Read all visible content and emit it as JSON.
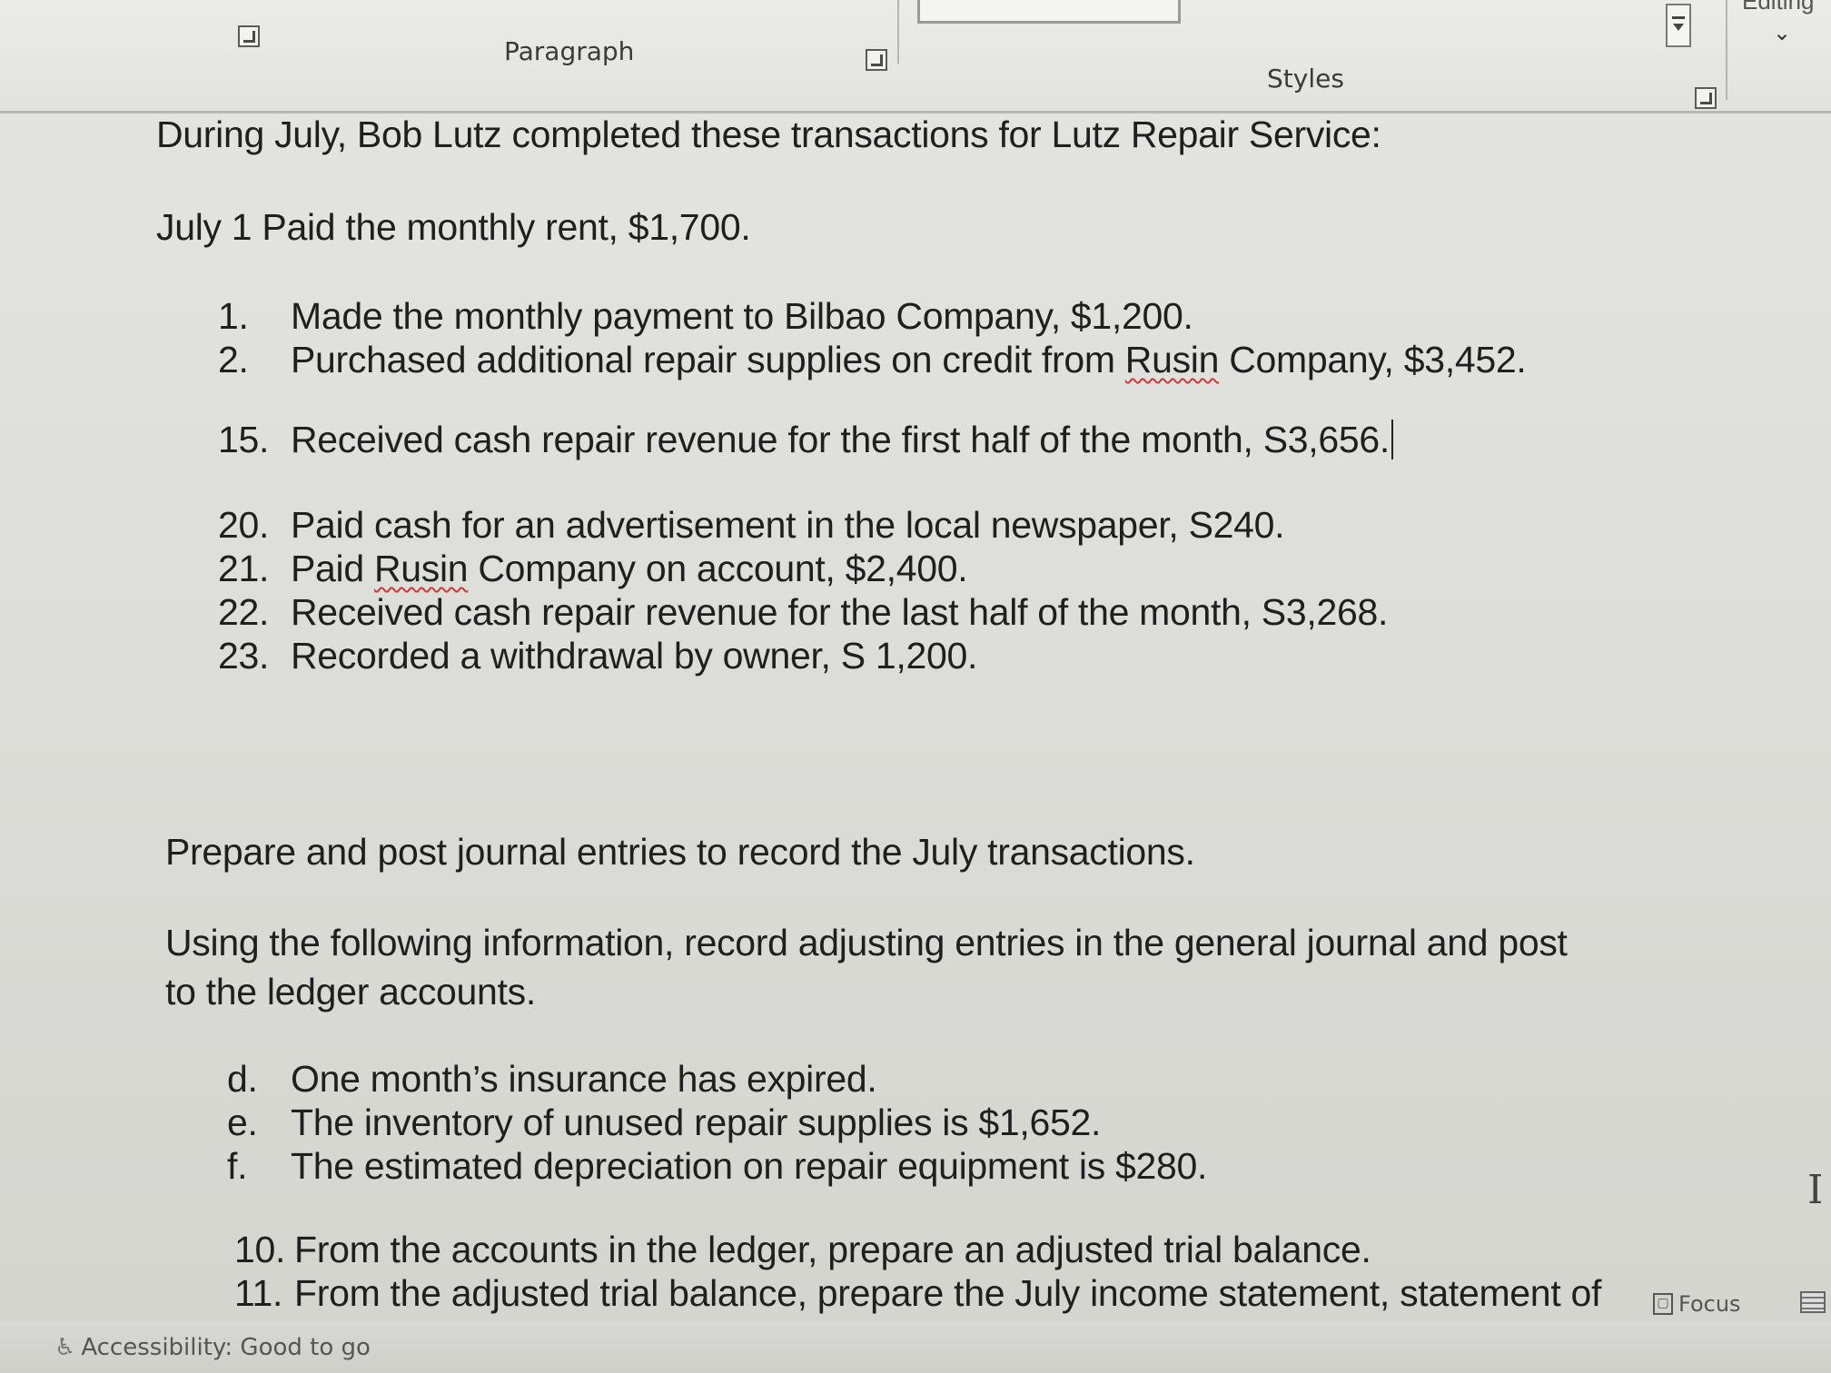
{
  "ribbon": {
    "paragraph_label": "Paragraph",
    "styles_label": "Styles",
    "editing_label": "Editing",
    "collapse_glyph": "⌄"
  },
  "document": {
    "heading": "During July, Bob Lutz completed these transactions for Lutz Repair Service:",
    "first_transaction": "July 1 Paid the monthly rent, $1,700.",
    "transactions": [
      {
        "num": "1.",
        "pre": "Made the monthly payment to Bilbao Company, $1,200.",
        "flagged": "",
        "post": ""
      },
      {
        "num": "2.",
        "pre": "Purchased additional repair supplies on credit from ",
        "flagged": "Rusin",
        "post": " Company, $3,452."
      },
      {
        "num": "15.",
        "pre": "Received cash repair revenue for the first half of the month, S3,656.",
        "flagged": "",
        "post": ""
      },
      {
        "num": "20.",
        "pre": "Paid cash for an advertisement in the local newspaper, S240.",
        "flagged": "",
        "post": ""
      },
      {
        "num": "21.",
        "pre": "Paid ",
        "flagged": "Rusin",
        "post": " Company on account, $2,400."
      },
      {
        "num": "22.",
        "pre": "Received cash repair revenue for the last half of the month, S3,268.",
        "flagged": "",
        "post": ""
      },
      {
        "num": "23.",
        "pre": "Recorded a withdrawal by owner, S 1,200.",
        "flagged": "",
        "post": ""
      }
    ],
    "instruction_1": "Prepare and post journal entries to record the July transactions.",
    "instruction_2_line1": "Using the following information, record adjusting entries in the general journal and post",
    "instruction_2_line2": "to the ledger accounts.",
    "adjustments": [
      {
        "letter": "d.",
        "text": "One month’s insurance has expired."
      },
      {
        "letter": "e.",
        "text": "The inventory of unused repair supplies is $1,652."
      },
      {
        "letter": "f.",
        "text": "The estimated depreciation on repair equipment is $280."
      }
    ],
    "steps": [
      {
        "num": "10.",
        "text": "From the accounts in the ledger, prepare an adjusted trial balance."
      },
      {
        "num": "11.",
        "text": "From the adjusted trial balance, prepare the July income statement, statement of"
      }
    ]
  },
  "statusbar": {
    "accessibility": "Accessibility: Good to go",
    "focus": "Focus"
  },
  "colors": {
    "spellcheck": "#c93a3a",
    "text": "#1f1f1f",
    "ribbon_bg": "#e6e6e2"
  }
}
